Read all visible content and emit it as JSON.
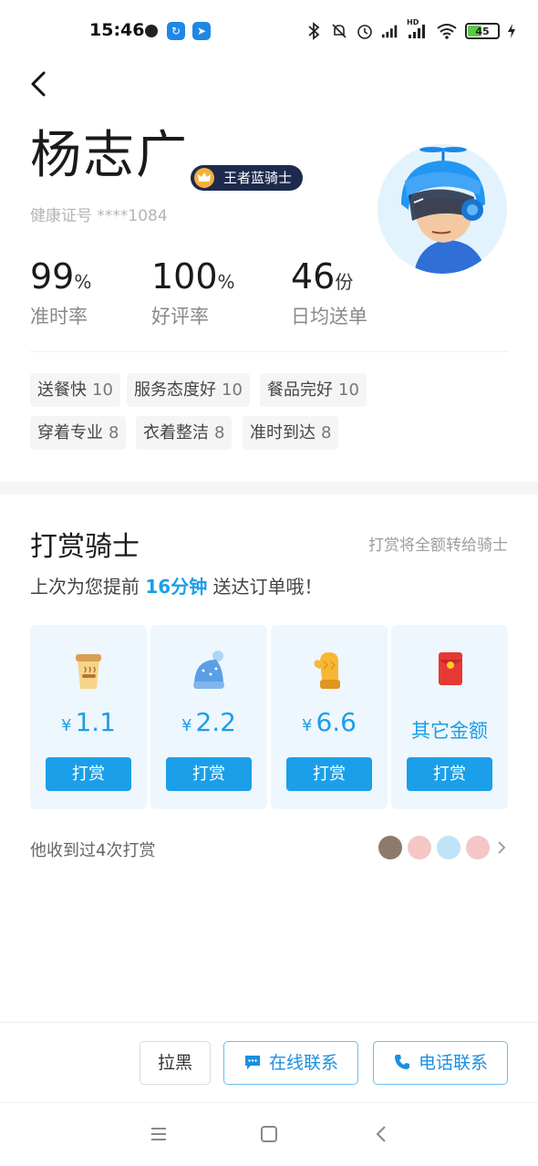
{
  "status_bar": {
    "time": "15:46",
    "battery": "45",
    "signal_label": "HD"
  },
  "rider": {
    "name": "杨志广",
    "badge": "王者蓝骑士",
    "health_cert": "健康证号 ****1084"
  },
  "stats": [
    {
      "value": "99",
      "unit": "%",
      "label": "准时率"
    },
    {
      "value": "100",
      "unit": "%",
      "label": "好评率"
    },
    {
      "value": "46",
      "unit": "份",
      "label": "日均送单"
    }
  ],
  "tags": [
    {
      "label": "送餐快",
      "count": "10"
    },
    {
      "label": "服务态度好",
      "count": "10"
    },
    {
      "label": "餐品完好",
      "count": "10"
    },
    {
      "label": "穿着专业",
      "count": "8"
    },
    {
      "label": "衣着整洁",
      "count": "8"
    },
    {
      "label": "准时到达",
      "count": "8"
    }
  ],
  "tip": {
    "title": "打赏骑士",
    "hint": "打赏将全额转给骑士",
    "desc_prefix": "上次为您提前 ",
    "desc_highlight": "16分钟",
    "desc_suffix": " 送达订单哦！",
    "options": [
      {
        "icon": "coffee-cup-icon",
        "currency": "¥",
        "amount": "1.1",
        "button": "打赏"
      },
      {
        "icon": "knit-hat-icon",
        "currency": "¥",
        "amount": "2.2",
        "button": "打赏"
      },
      {
        "icon": "mitten-icon",
        "currency": "¥",
        "amount": "6.6",
        "button": "打赏"
      },
      {
        "icon": "red-envelope-icon",
        "label": "其它金额",
        "button": "打赏"
      }
    ],
    "received": "他收到过4次打赏"
  },
  "actions": {
    "block": "拉黑",
    "online": "在线联系",
    "phone": "电话联系"
  },
  "colors": {
    "accent": "#1a9fe8",
    "badge_bg": "#1d2a4e",
    "card_bg": "#eef7fd"
  }
}
